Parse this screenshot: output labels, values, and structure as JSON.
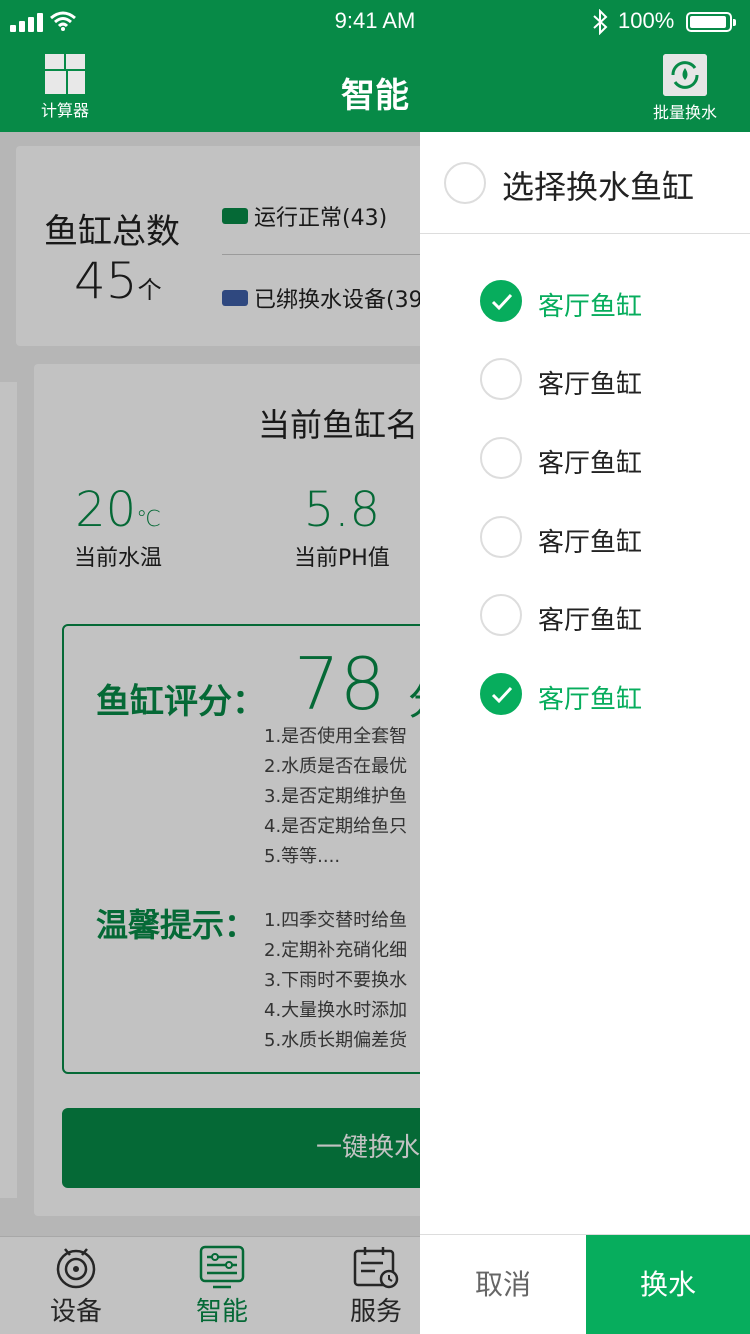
{
  "status_bar": {
    "time": "9:41 AM",
    "battery": "100%"
  },
  "header": {
    "title": "智能",
    "left_action": {
      "label": "计算器",
      "icon": "calculator-icon"
    },
    "right_action": {
      "label": "批量换水",
      "icon": "water-change-icon"
    }
  },
  "summary": {
    "title": "鱼缸总数",
    "count": "45",
    "unit": "个",
    "legend": [
      {
        "label": "运行正常(43)",
        "color": "#078a47"
      },
      {
        "label": "已绑换水设备(39",
        "color": "#3f5fa8"
      }
    ]
  },
  "main": {
    "tank_name": "当前鱼缸名",
    "stats": [
      {
        "value": "20",
        "unit": "℃",
        "label": "当前水温"
      },
      {
        "value": "5.8",
        "unit": "",
        "label": "当前PH值"
      }
    ],
    "score": {
      "title": "鱼缸评分：",
      "value": "78",
      "unit": "分",
      "items": [
        "1.是否使用全套智",
        "2.水质是否在最优",
        "3.是否定期维护鱼",
        "4.是否定期给鱼只",
        "5.等等...."
      ]
    },
    "tips": {
      "title": "温馨提示：",
      "items": [
        "1.四季交替时给鱼",
        "2.定期补充硝化细",
        "3.下雨时不要换水",
        "4.大量换水时添加",
        "5.水质长期偏差货"
      ]
    },
    "onekey_label": "一键换水"
  },
  "tabbar": {
    "items": [
      {
        "label": "设备",
        "icon": "device-icon",
        "active": false
      },
      {
        "label": "智能",
        "icon": "smart-icon",
        "active": true
      },
      {
        "label": "服务",
        "icon": "service-icon",
        "active": false
      }
    ]
  },
  "drawer": {
    "title": "选择换水鱼缸",
    "select_all_checked": false,
    "tanks": [
      {
        "label": "客厅鱼缸",
        "checked": true
      },
      {
        "label": "客厅鱼缸",
        "checked": false
      },
      {
        "label": "客厅鱼缸",
        "checked": false
      },
      {
        "label": "客厅鱼缸",
        "checked": false
      },
      {
        "label": "客厅鱼缸",
        "checked": false
      },
      {
        "label": "客厅鱼缸",
        "checked": true
      }
    ],
    "cancel_label": "取消",
    "confirm_label": "换水"
  },
  "colors": {
    "primary": "#078a47",
    "accent": "#07ad5d"
  }
}
